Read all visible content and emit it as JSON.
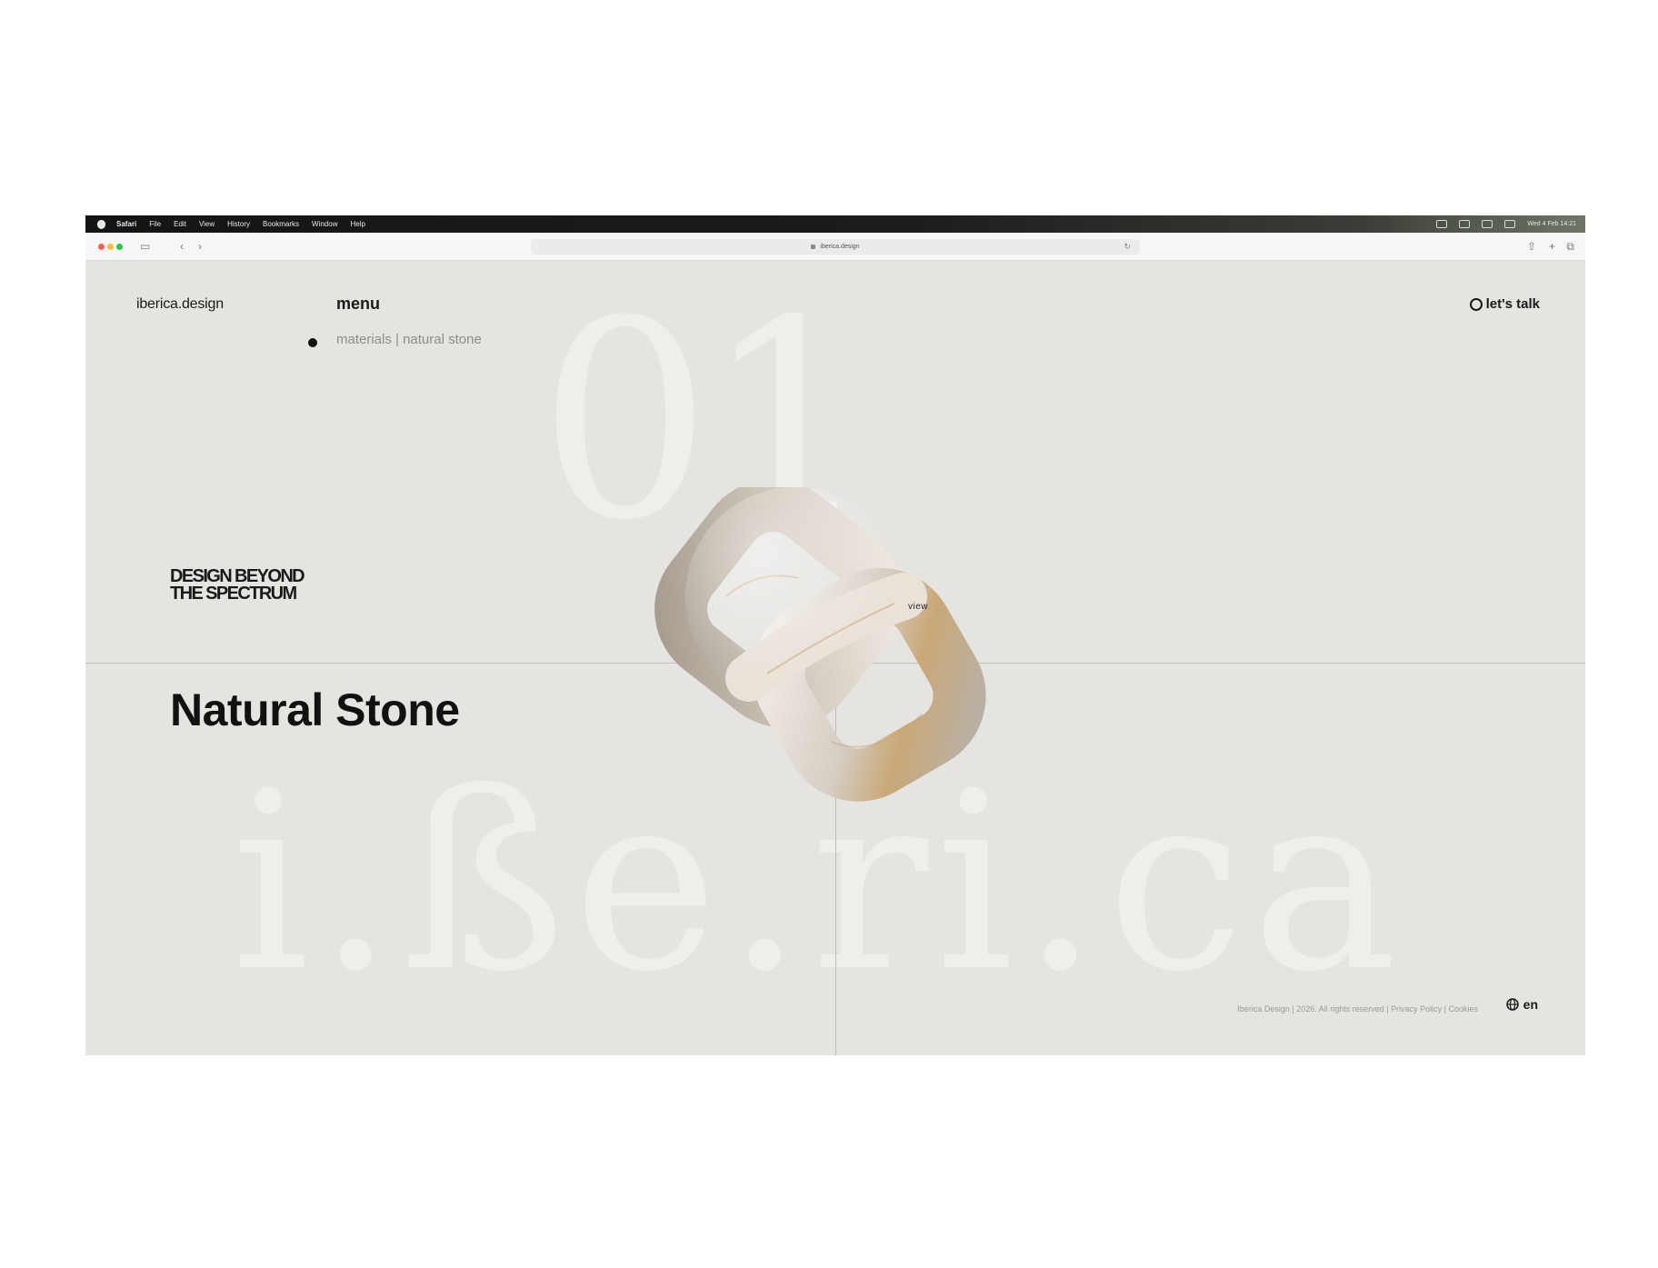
{
  "menubar": {
    "app_name": "Safari",
    "items": [
      "File",
      "Edit",
      "View",
      "History",
      "Bookmarks",
      "Window",
      "Help"
    ],
    "clock": "Wed 4 Feb 14:21"
  },
  "browser": {
    "url": "iberica.design"
  },
  "header": {
    "logo": "iberica.design",
    "menu_label": "menu",
    "breadcrumb": "materials | natural stone",
    "cta_label": "let's talk"
  },
  "hero": {
    "bg_number": "01",
    "bg_word": "i.ße.ri.ca",
    "tagline": "DESIGN BEYOND\nTHE SPECTRUM",
    "headline": "Natural Stone",
    "view_label": "view"
  },
  "footer": {
    "copyright": "Iberica Design | 2026. All rights reserved  |  Privacy Policy  |  Cookies",
    "language": "en"
  },
  "colors": {
    "page_background": "#e5e4e1",
    "text": "#1a1a1a",
    "stone": "#d9d3ca",
    "stone_vein": "#c9a877"
  }
}
